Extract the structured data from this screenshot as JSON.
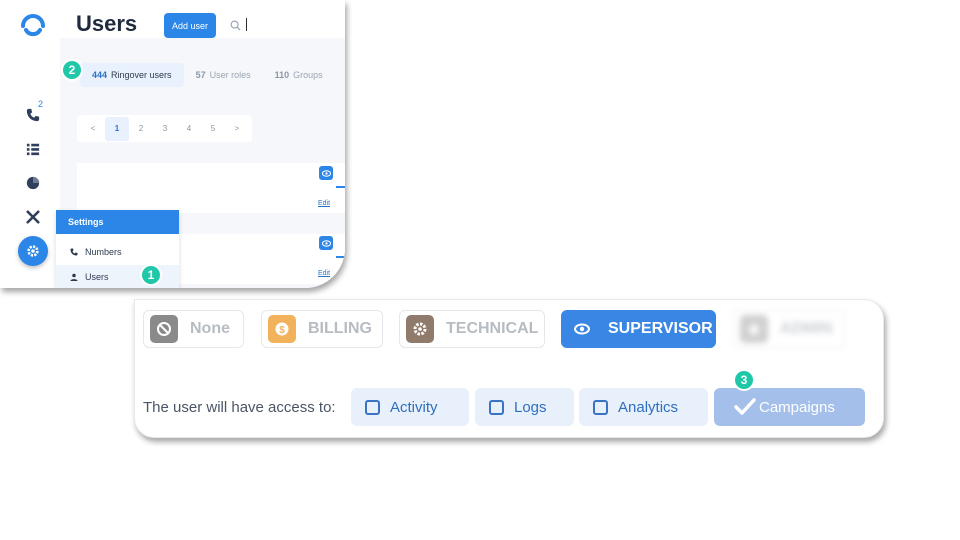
{
  "header": {
    "title": "Users",
    "add_user_label": "Add user"
  },
  "sidebar": {
    "call_badge": "2"
  },
  "tabs": [
    {
      "count": "444",
      "label": "Ringover users"
    },
    {
      "count": "57",
      "label": "User roles"
    },
    {
      "count": "110",
      "label": "Groups"
    }
  ],
  "pagination": {
    "prev": "<",
    "pages": [
      "1",
      "2",
      "3",
      "4",
      "5"
    ],
    "next": ">",
    "current": "1"
  },
  "rows": [
    {
      "edit_label": "Edit"
    },
    {
      "edit_label": "Edit"
    }
  ],
  "settings_menu": {
    "title": "Settings",
    "items": [
      {
        "label": "Numbers",
        "icon": "phone-icon"
      },
      {
        "label": "Users",
        "icon": "user-icon"
      }
    ]
  },
  "roles": [
    {
      "label": "None",
      "icon": "ban-icon",
      "icon_color": "#8a8a8a"
    },
    {
      "label": "BILLING",
      "icon": "dollar-icon",
      "icon_color": "#f2b25c"
    },
    {
      "label": "TECHNICAL",
      "icon": "gear-icon",
      "icon_color": "#8f7a6c"
    },
    {
      "label": "SUPERVISOR",
      "icon": "eye-icon",
      "selected": true
    },
    {
      "label": "ADMIN",
      "icon": "star-icon",
      "icon_color": "#bdbdbd"
    }
  ],
  "access": {
    "label": "The user will have access to:",
    "permissions": [
      {
        "label": "Activity",
        "checked": false
      },
      {
        "label": "Logs",
        "checked": false
      },
      {
        "label": "Analytics",
        "checked": false
      },
      {
        "label": "Campaigns",
        "checked": true
      }
    ]
  },
  "callouts": [
    "1",
    "2",
    "3"
  ],
  "colors": {
    "accent": "#2b86e8",
    "callout": "#1ec8a8",
    "role_selected": "#3a86e5"
  }
}
